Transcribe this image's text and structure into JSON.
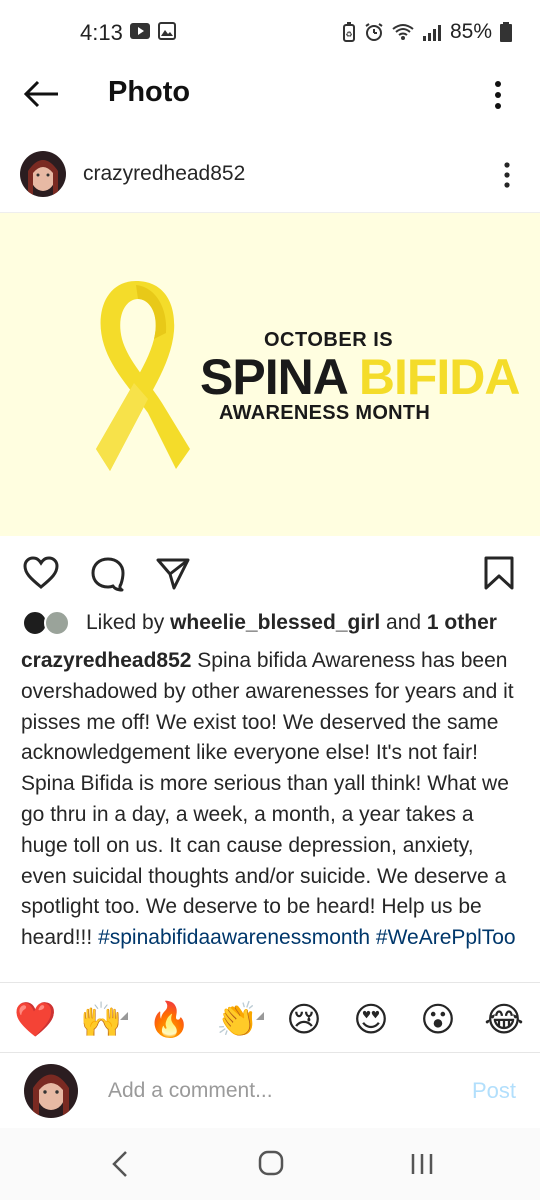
{
  "status_bar": {
    "time": "4:13",
    "battery": "85%"
  },
  "header": {
    "title": "Photo"
  },
  "post": {
    "username": "crazyredhead852",
    "image": {
      "line1": "OCTOBER IS",
      "line2_word1": "SPINA",
      "line2_word2": "BIFIDA",
      "line3": "AWARENESS MONTH",
      "ribbon_color": "#f4dc2a",
      "background_color": "#fffee0"
    },
    "likes": {
      "prefix": "Liked by",
      "liker": "wheelie_blessed_girl",
      "middle": "and",
      "others": "1 other"
    },
    "caption": {
      "username": "crazyredhead852",
      "text": "Spina bifida Awareness has been overshadowed by other awarenesses for years and it pisses me off! We exist too! We deserved the same acknowledgement like everyone else! It's not fair! Spina Bifida is more serious than yall think! What we go thru in a day, a week, a month, a year takes a huge toll on us. It can cause depression, anxiety, even suicidal thoughts and/or suicide. We deserve a spotlight too. We deserve to be heard! Help us be heard!!!",
      "hashtag1": "#spinabifidaawarenessmonth",
      "hashtag2": "#WeArePplToo"
    }
  },
  "emoji_reactions": [
    "❤️",
    "🙌",
    "🔥",
    "👏",
    "😢",
    "😍",
    "😮",
    "😂"
  ],
  "comment": {
    "placeholder": "Add a comment...",
    "post_label": "Post",
    "post_color": "#b2dffc"
  },
  "nav": {
    "icons": [
      "back-icon",
      "home-icon",
      "recents-icon"
    ]
  }
}
